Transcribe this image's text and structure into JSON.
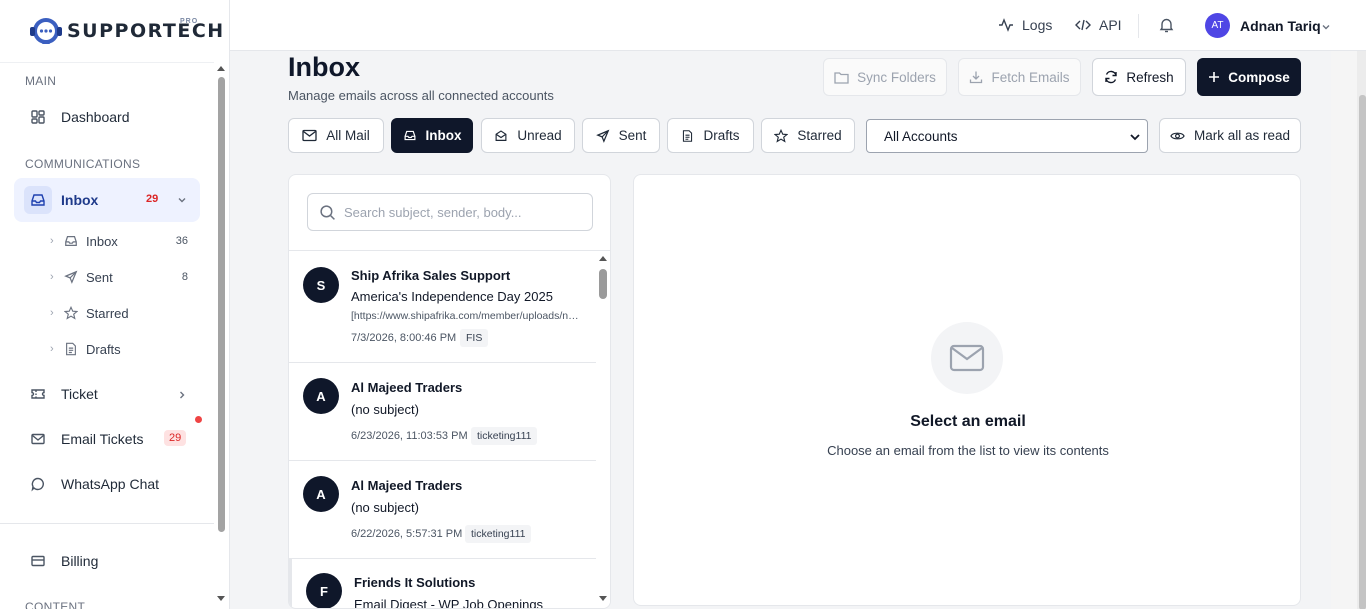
{
  "brand": {
    "name": "SUPPORTECH",
    "tag": "PRO"
  },
  "sidebar": {
    "sections": {
      "main": "MAIN",
      "communications": "COMMUNICATIONS",
      "content": "CONTENT"
    },
    "dashboard": "Dashboard",
    "inbox": {
      "label": "Inbox",
      "count": "29"
    },
    "sub_items": [
      {
        "label": "Inbox",
        "count": "36"
      },
      {
        "label": "Sent",
        "count": "8"
      },
      {
        "label": "Starred"
      },
      {
        "label": "Drafts"
      }
    ],
    "ticket": "Ticket",
    "email_tickets": {
      "label": "Email Tickets",
      "count": "29"
    },
    "whatsapp": "WhatsApp Chat",
    "billing": "Billing"
  },
  "topbar": {
    "logs": "Logs",
    "api": "API",
    "user": {
      "initials": "AT",
      "name": "Adnan Tariq"
    }
  },
  "page": {
    "title": "Inbox",
    "subtitle": "Manage emails across all connected accounts",
    "actions": {
      "sync": "Sync Folders",
      "fetch": "Fetch Emails",
      "refresh": "Refresh",
      "compose": "Compose"
    }
  },
  "filters": {
    "all": "All Mail",
    "inbox": "Inbox",
    "unread": "Unread",
    "sent": "Sent",
    "drafts": "Drafts",
    "starred": "Starred",
    "account": "All Accounts",
    "mark_read": "Mark all as read"
  },
  "search": {
    "placeholder": "Search subject, sender, body..."
  },
  "emails": [
    {
      "initial": "S",
      "from": "Ship Afrika Sales Support",
      "subject": "America's Independence Day 2025",
      "preview": "[https://www.shipafrika.com/member/uploads/newsletter",
      "date": "7/3/2026, 8:00:46 PM",
      "tag": "FIS"
    },
    {
      "initial": "A",
      "from": "Al Majeed Traders",
      "subject": "(no subject)",
      "preview": "",
      "date": "6/23/2026, 11:03:53 PM",
      "tag": "ticketing111"
    },
    {
      "initial": "A",
      "from": "Al Majeed Traders",
      "subject": "(no subject)",
      "preview": "",
      "date": "6/22/2026, 5:57:31 PM",
      "tag": "ticketing111"
    },
    {
      "initial": "F",
      "from": "Friends It Solutions",
      "subject": "Email Digest - WP Job Openings",
      "preview": "",
      "date": "",
      "tag": ""
    }
  ],
  "detail": {
    "title": "Select an email",
    "subtitle": "Choose an email from the list to view its contents"
  },
  "colors": {
    "accent": "#0f172a",
    "active_nav": "#eef2ff",
    "badge": "#dc2626"
  }
}
